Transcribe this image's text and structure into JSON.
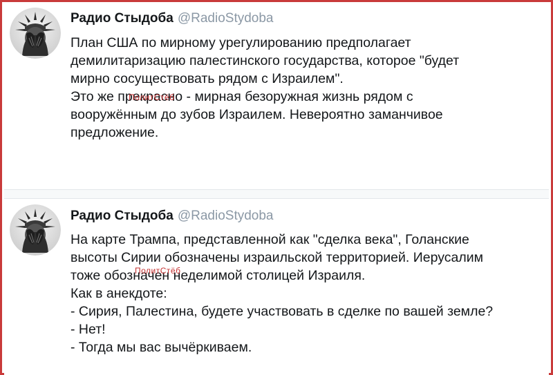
{
  "tweets": [
    {
      "name": "Радио Стыдоба",
      "handle": "@RadioStydoba",
      "avatar_icon": "statue-of-liberty-facepalm-avatar",
      "lines": [
        "План США по мирному урегулированию предполагает",
        "демилитаризацию палестинского государства, которое \"будет",
        "мирно сосуществовать рядом с Израилем\".",
        "Это же прекрасно - мирная безоружная жизнь рядом с",
        "вооружённым до зубов Израилем. Невероятно заманчивое",
        "предложение."
      ],
      "watermark": "ПолитСтёб"
    },
    {
      "name": "Радио Стыдоба",
      "handle": "@RadioStydoba",
      "avatar_icon": "statue-of-liberty-facepalm-avatar",
      "lines": [
        "На карте Трампа, представленной как \"сделка века\", Голанские",
        "высоты Сирии обозначены израильской территорией. Иерусалим",
        "тоже обозначен неделимой столицей Израиля.",
        "Как в анекдоте:",
        "- Сирия, Палестина, будете участвовать в сделке по вашей земле?",
        "- Нет!",
        "- Тогда мы вас вычёркиваем."
      ],
      "watermark": "ПолитСтёб"
    }
  ],
  "colors": {
    "border": "#c93a3a",
    "handle": "#8b98a5",
    "text": "#14171a",
    "watermark": "#c43030"
  }
}
